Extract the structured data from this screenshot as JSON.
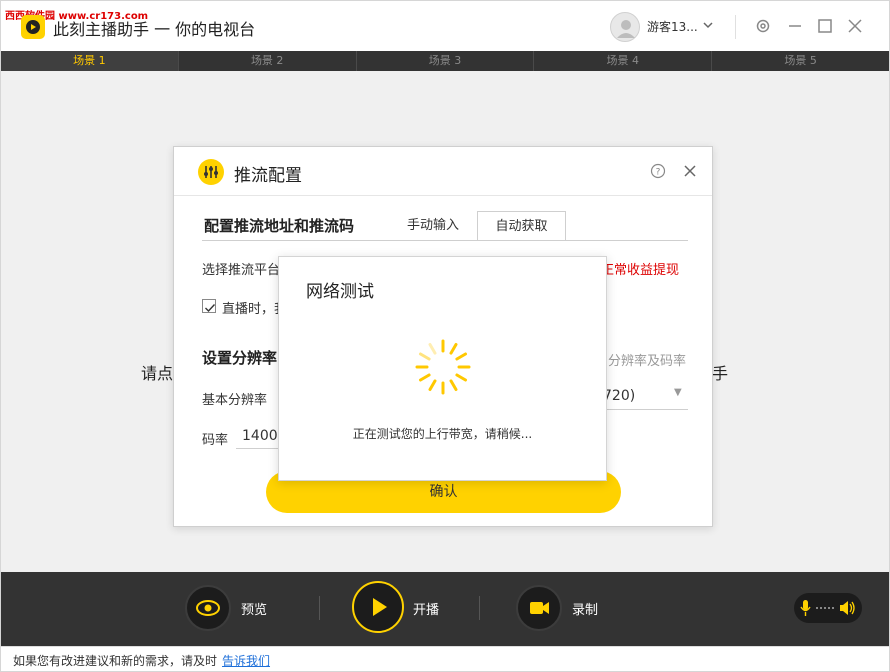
{
  "watermark": "西西软件园 www.cr173.com",
  "window": {
    "title": "此刻主播助手 一 你的电视台",
    "username": "游客13..."
  },
  "scenes": [
    "场景 1",
    "场景 2",
    "场景 3",
    "场景 4",
    "场景 5"
  ],
  "background": {
    "left_text": "请点",
    "right_text": "手"
  },
  "dialog": {
    "title": "推流配置",
    "section_stream": "配置推流地址和推流码",
    "tabs": [
      "手动输入",
      "自动获取"
    ],
    "active_tab": "自动获取",
    "platform_label": "选择推流平台",
    "revenue_link": "正常收益提现",
    "checkbox_label": "直播时，我",
    "section_resolution": "设置分辨率",
    "resolution_link": "分辨率及码率",
    "base_resolution_label": "基本分辨率",
    "resolution_value": "720)",
    "bitrate_label": "码率",
    "bitrate_value": "1400",
    "confirm_label": "确认"
  },
  "network_test": {
    "title": "网络测试",
    "message": "正在测试您的上行带宽，请稍候..."
  },
  "controls": {
    "preview": "预览",
    "start": "开播",
    "record": "录制"
  },
  "status": {
    "text": "如果您有改进建议和新的需求，请及时",
    "link": "告诉我们"
  },
  "colors": {
    "accent": "#ffd200",
    "active_tab_text": "#ffc800",
    "link_red": "#dd0000",
    "link_blue": "#1e6fd9"
  }
}
